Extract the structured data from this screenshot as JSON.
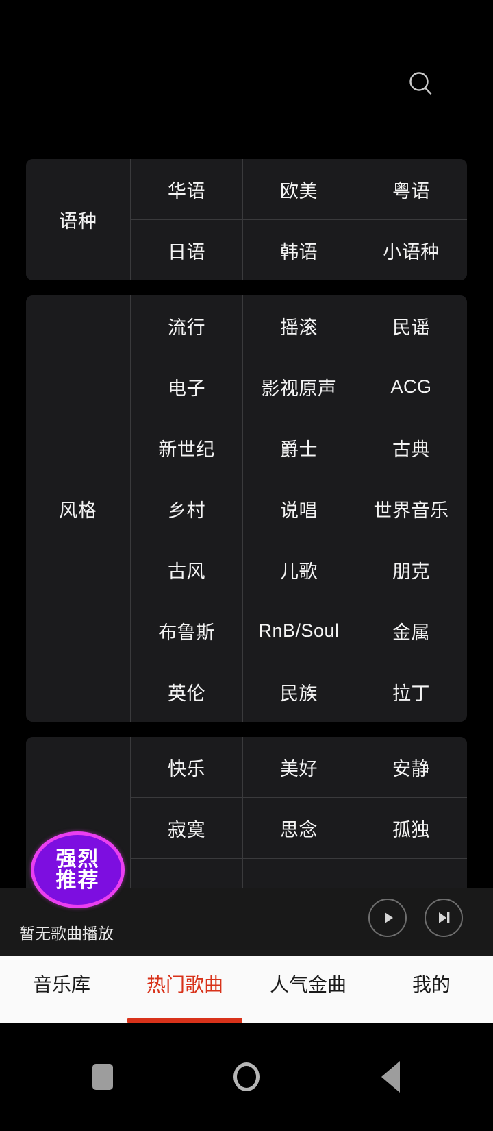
{
  "header": {
    "search_icon": "search-icon"
  },
  "sections": [
    {
      "label": "语种",
      "rows": [
        [
          "华语",
          "欧美",
          "粤语"
        ],
        [
          "日语",
          "韩语",
          "小语种"
        ]
      ]
    },
    {
      "label": "风格",
      "rows": [
        [
          "流行",
          "摇滚",
          "民谣"
        ],
        [
          "电子",
          "影视原声",
          "ACG"
        ],
        [
          "新世纪",
          "爵士",
          "古典"
        ],
        [
          "乡村",
          "说唱",
          "世界音乐"
        ],
        [
          "古风",
          "儿歌",
          "朋克"
        ],
        [
          "布鲁斯",
          "RnB/Soul",
          "金属"
        ],
        [
          "英伦",
          "民族",
          "拉丁"
        ]
      ]
    },
    {
      "label": "",
      "rows": [
        [
          "快乐",
          "美好",
          "安静"
        ],
        [
          "寂寞",
          "思念",
          "孤独"
        ]
      ]
    }
  ],
  "badge": {
    "line1": "强烈",
    "line2": "推荐",
    "fill_color": "#7d0ee0",
    "border_color": "#ea3ff0"
  },
  "player": {
    "title": "暂无歌曲播放",
    "play_icon": "play-icon",
    "next_icon": "next-track-icon"
  },
  "tabs": [
    {
      "label": "音乐库",
      "active": false
    },
    {
      "label": "热门歌曲",
      "active": true
    },
    {
      "label": "人气金曲",
      "active": false
    },
    {
      "label": "我的",
      "active": false
    }
  ],
  "tab_accent_color": "#d8321a",
  "navbar": {
    "recents_icon": "square-recents-icon",
    "home_icon": "circle-home-icon",
    "back_icon": "triangle-back-icon"
  }
}
